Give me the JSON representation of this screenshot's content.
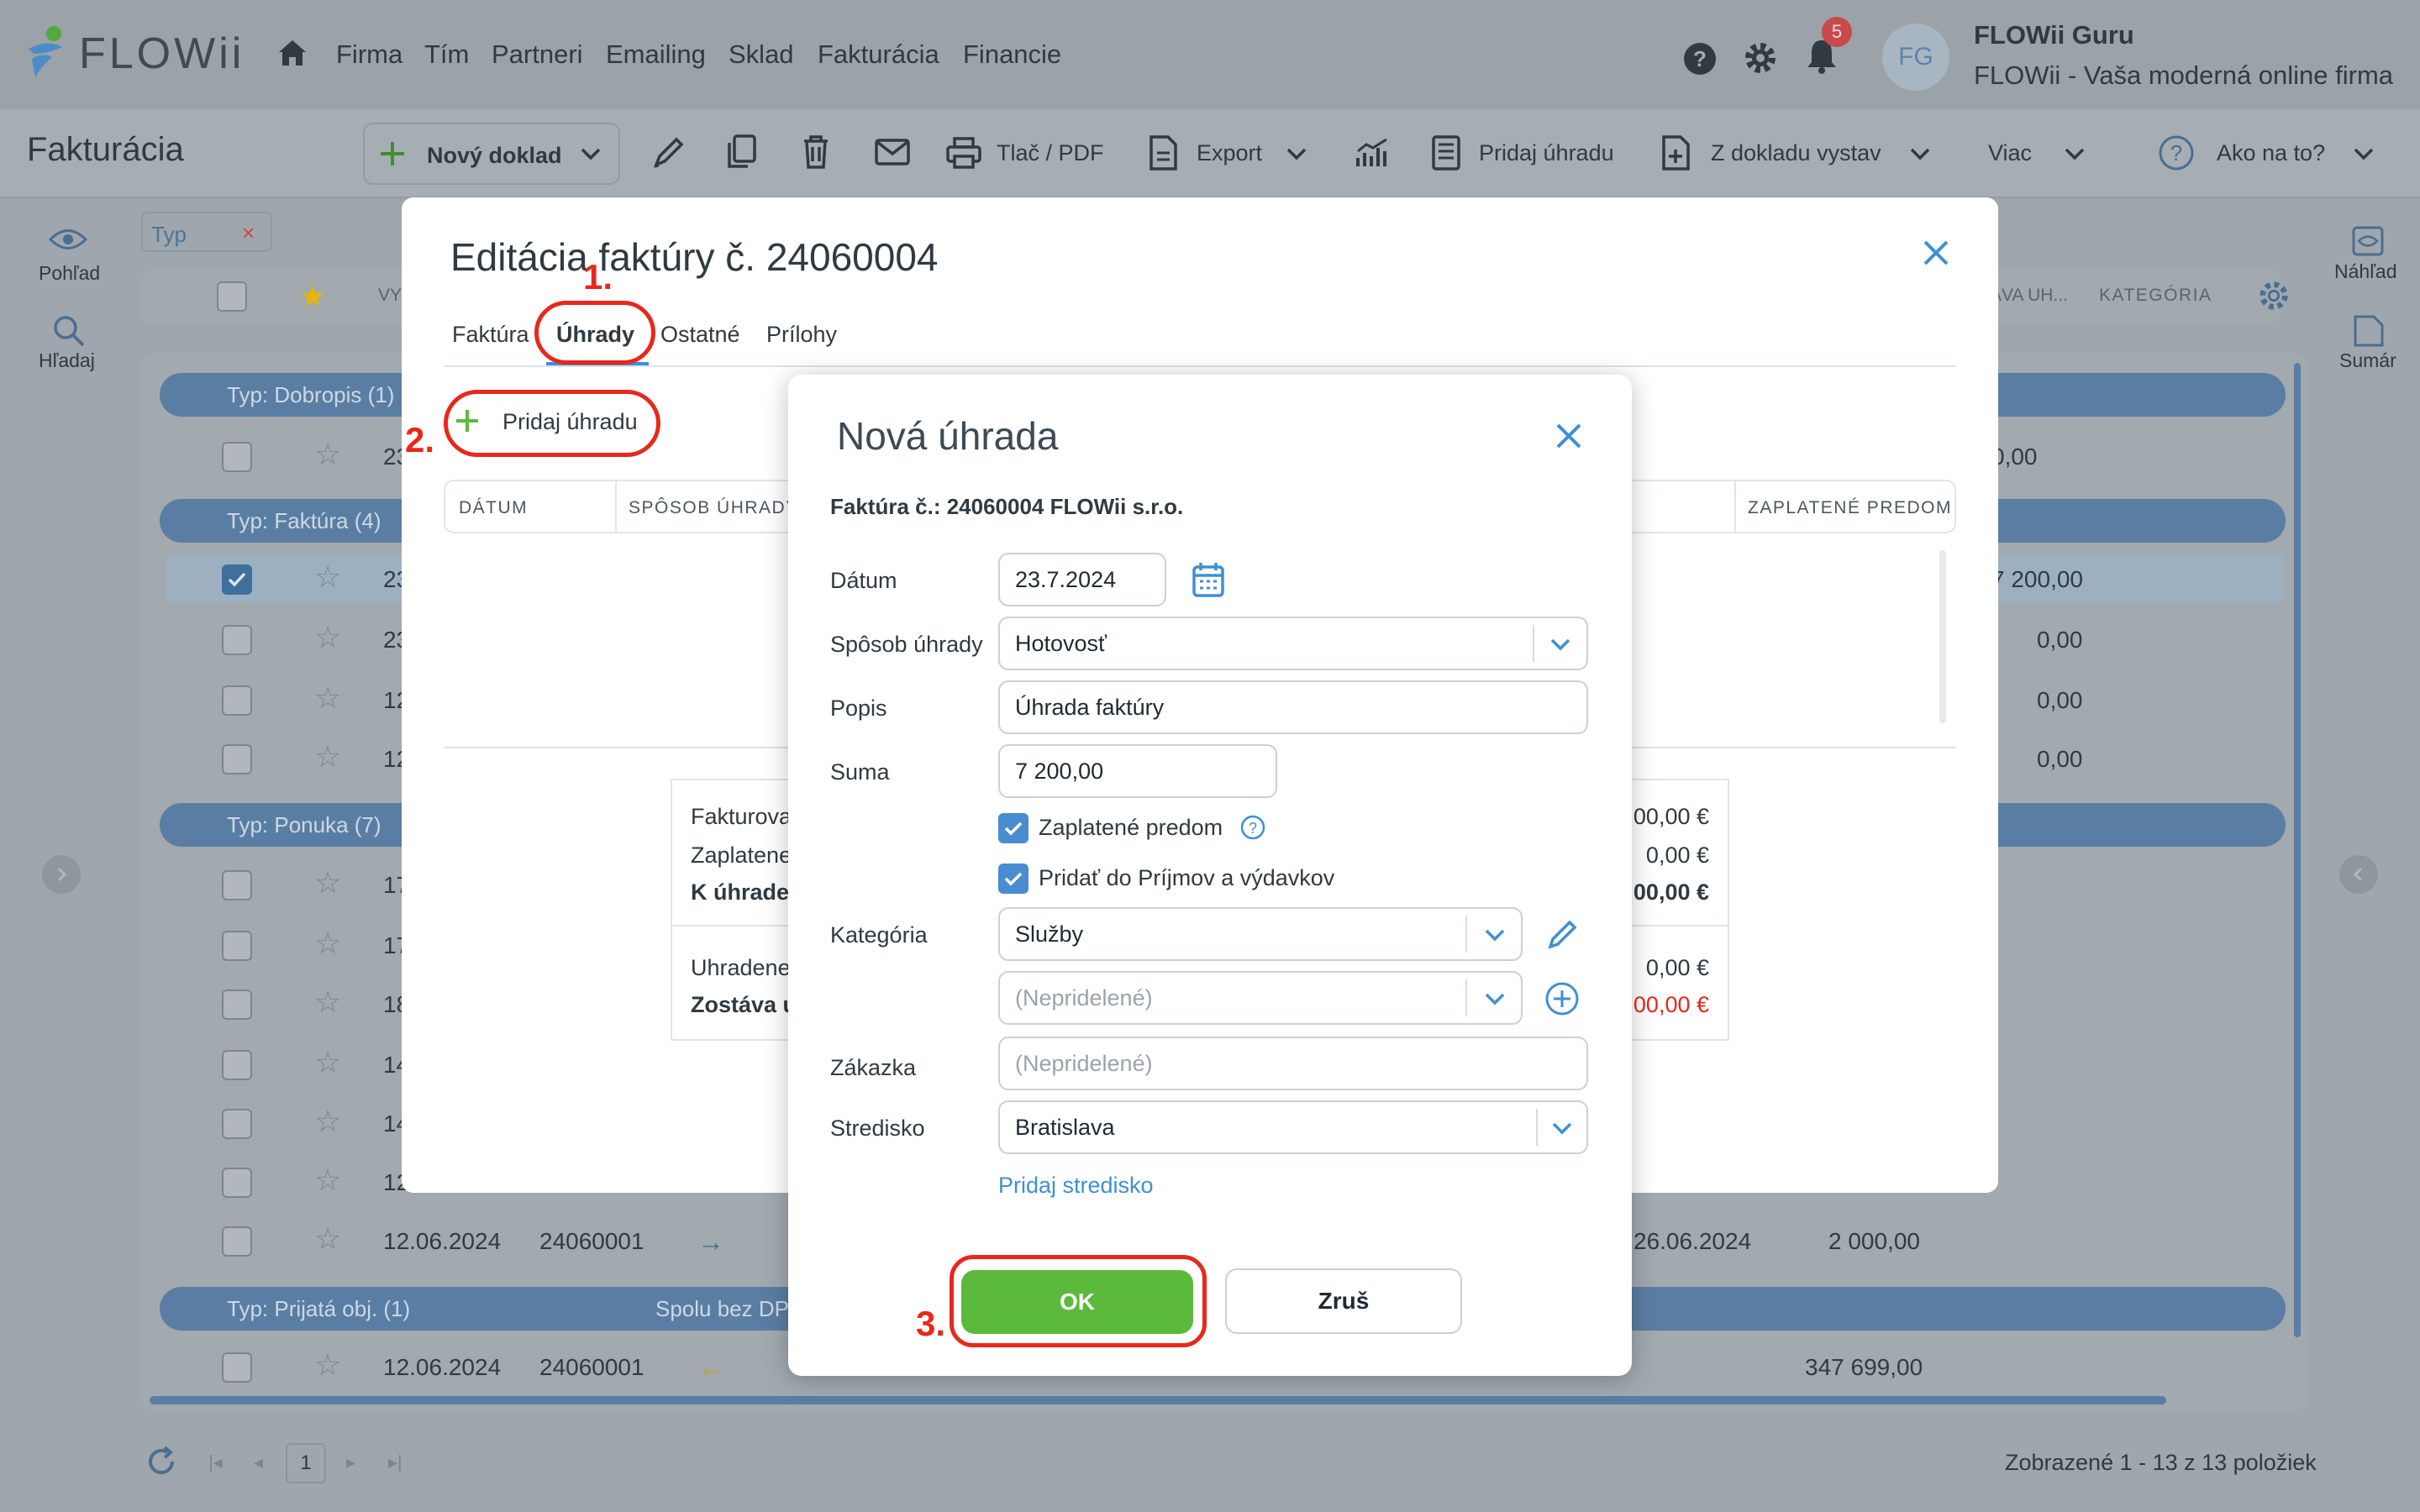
{
  "app": {
    "logo_text": "FLOWii",
    "nav": [
      "Firma",
      "Tím",
      "Partneri",
      "Emailing",
      "Sklad",
      "Fakturácia",
      "Financie"
    ],
    "notif_count": "5",
    "avatar_initials": "FG",
    "user_name": "FLOWii Guru",
    "user_company": "FLOWii - Vaša moderná online firma"
  },
  "toolbar": {
    "page_title": "Fakturácia",
    "new_doc": "Nový doklad",
    "print": "Tlač / PDF",
    "export": "Export",
    "add_payment": "Pridaj úhradu",
    "from_doc": "Z dokladu vystav",
    "more": "Viac",
    "howto": "Ako na to?"
  },
  "side_left": {
    "view": "Pohľad",
    "search": "Hľadaj"
  },
  "side_right": {
    "preview": "Náhľad",
    "summary": "Sumár"
  },
  "filter": {
    "chip": "Typ",
    "col_hdr_1": "VY",
    "col_hdr_2": "ÁVA UH...",
    "col_hdr_3": "KATEGÓRIA"
  },
  "groups": [
    {
      "label": "Typ: Dobropis (1)"
    },
    {
      "label": "Typ: Faktúra (4)"
    },
    {
      "label": "Typ: Ponuka (7)"
    },
    {
      "label": "Typ: Prijatá obj. (1)",
      "extra": "Spolu bez DPH"
    }
  ],
  "rows": {
    "dobropis": [
      {
        "num": "23",
        "amount": "0,00"
      }
    ],
    "faktura": [
      {
        "num": "23",
        "amount": "7 200,00",
        "checked": true
      },
      {
        "num": "23",
        "amount": "0,00"
      },
      {
        "num": "12",
        "amount": "0,00"
      },
      {
        "num": "12",
        "amount": "0,00"
      }
    ],
    "ponuka": [
      "17",
      "17",
      "18",
      "14",
      "14",
      "12"
    ],
    "ponuka_last": {
      "date": "12.06.2024",
      "doc": "24060001",
      "due": "26.06.2024",
      "amount": "2 000,00"
    },
    "prijata": {
      "date": "12.06.2024",
      "doc": "24060001",
      "amount": "347 699,00"
    }
  },
  "footer": {
    "page": "1",
    "summary": "Zobrazené 1 - 13 z 13 položiek"
  },
  "modal1": {
    "title": "Editácia faktúry č. 24060004",
    "tabs": [
      "Faktúra",
      "Úhrady",
      "Ostatné",
      "Prílohy"
    ],
    "add_payment": "Pridaj úhradu",
    "columns": [
      "DÁTUM",
      "SPÔSOB ÚHRADY",
      "ZAPLATENÉ PREDOM"
    ],
    "summary_labels": [
      "Fakturova",
      "Zaplatene",
      "K úhrade",
      "Uhradene",
      "Zostáva u"
    ],
    "summary_values": [
      "00,00 €",
      "0,00 €",
      "00,00 €",
      "0,00 €",
      "00,00 €"
    ]
  },
  "modal2": {
    "title": "Nová úhrada",
    "subtitle": "Faktúra č.: 24060004 FLOWii s.r.o.",
    "labels": {
      "date": "Dátum",
      "method": "Spôsob úhrady",
      "desc": "Popis",
      "sum": "Suma",
      "category": "Kategória",
      "order": "Zákazka",
      "center": "Stredisko"
    },
    "values": {
      "date": "23.7.2024",
      "method": "Hotovosť",
      "desc": "Úhrada faktúry",
      "sum": "7 200,00",
      "category": "Služby",
      "subcategory_placeholder": "(Nepridelené)",
      "order_placeholder": "(Nepridelené)",
      "center": "Bratislava"
    },
    "checkbox_prepaid": "Zaplatené predom",
    "checkbox_income": "Pridať do Príjmov a výdavkov",
    "add_center": "Pridaj stredisko",
    "ok": "OK",
    "cancel": "Zruš"
  },
  "annotations": [
    "1.",
    "2.",
    "3."
  ],
  "colors": {
    "accent": "#3e8fd6",
    "ok": "#5bba3b",
    "annotation": "#e8281b",
    "group": "#5a7ea3"
  }
}
